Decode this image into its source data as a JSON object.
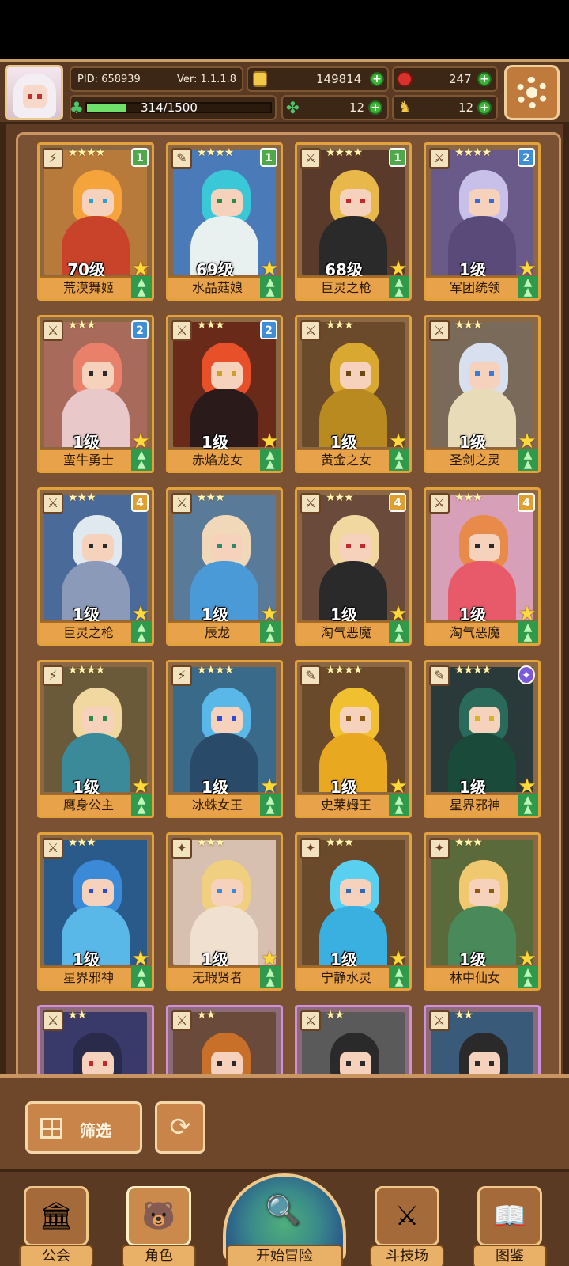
{
  "header": {
    "pid": "PID: 658939",
    "version": "Ver: 1.1.1.8",
    "energy": "314/1500",
    "energy_fraction": 0.21,
    "gold": "149814",
    "apples": "247",
    "clovers": "12",
    "trophies": "12"
  },
  "cards": [
    {
      "level": "70级",
      "name": "荒漠舞姬",
      "stars": "★★★★",
      "badge": "1",
      "badge_class": "b1",
      "type_icon": "⚡",
      "hair": "#f4a43a",
      "body": "#c8432a",
      "eye": "#2aa0d8",
      "bg": "#b87a3a"
    },
    {
      "level": "69级",
      "name": "水晶菇娘",
      "stars": "★★★★",
      "badge": "1",
      "badge_class": "b1",
      "type_icon": "✎",
      "hair": "#3ac8d8",
      "body": "#e8f0f0",
      "eye": "#2a8a4a",
      "bg": "#4a7ab8"
    },
    {
      "level": "68级",
      "name": "巨灵之枪",
      "stars": "★★★★",
      "badge": "1",
      "badge_class": "b1",
      "type_icon": "⚔",
      "hair": "#e8b84a",
      "body": "#2a2a2a",
      "eye": "#c02a2a",
      "bg": "#5a3a2a"
    },
    {
      "level": "1级",
      "name": "军团统领",
      "stars": "★★★★",
      "badge": "2",
      "badge_class": "b2",
      "type_icon": "⚔",
      "hair": "#c8c0e8",
      "body": "#5a4a7a",
      "eye": "#3a6ad8",
      "bg": "#6a5a8a"
    },
    {
      "level": "1级",
      "name": "蛮牛勇士",
      "stars": "★★★",
      "badge": "2",
      "badge_class": "b2",
      "type_icon": "⚔",
      "hair": "#e8806a",
      "body": "#e8c8c8",
      "eye": "#2a2a2a",
      "bg": "#a86a5a"
    },
    {
      "level": "1级",
      "name": "赤焰龙女",
      "stars": "★★★",
      "badge": "2",
      "badge_class": "b2",
      "type_icon": "⚔",
      "hair": "#e8502a",
      "body": "#2a1a1a",
      "eye": "#c8a02a",
      "bg": "#6a2a1a"
    },
    {
      "level": "1级",
      "name": "黄金之女",
      "stars": "★★★",
      "badge": "",
      "badge_class": "",
      "type_icon": "⚔",
      "hair": "#d8a830",
      "body": "#b88a20",
      "eye": "#6a4a10",
      "bg": "#6a4a2a"
    },
    {
      "level": "1级",
      "name": "圣剑之灵",
      "stars": "★★★",
      "badge": "",
      "badge_class": "",
      "type_icon": "⚔",
      "hair": "#d8e0f0",
      "body": "#e8dcb8",
      "eye": "#3a7ad8",
      "bg": "#7a6a5a"
    },
    {
      "level": "1级",
      "name": "巨灵之枪",
      "stars": "★★★",
      "badge": "4",
      "badge_class": "b4",
      "type_icon": "⚔",
      "hair": "#e0e8f0",
      "body": "#8a9ab8",
      "eye": "#2a2a2a",
      "bg": "#4a6a9a"
    },
    {
      "level": "1级",
      "name": "辰龙",
      "stars": "★★★",
      "badge": "",
      "badge_class": "",
      "type_icon": "⚔",
      "hair": "#f0d8b8",
      "body": "#4a9ad8",
      "eye": "#2a8a6a",
      "bg": "#5a7a9a"
    },
    {
      "level": "1级",
      "name": "淘气恶魔",
      "stars": "★★★",
      "badge": "4",
      "badge_class": "b4",
      "type_icon": "⚔",
      "hair": "#f0d8a0",
      "body": "#2a2a2a",
      "eye": "#c02a2a",
      "bg": "#6a4a3a"
    },
    {
      "level": "1级",
      "name": "淘气恶魔",
      "stars": "★★★",
      "badge": "4",
      "badge_class": "b4",
      "type_icon": "⚔",
      "hair": "#e88a4a",
      "body": "#e85a6a",
      "eye": "#2a2a2a",
      "bg": "#d8a0b8"
    },
    {
      "level": "1级",
      "name": "鹰身公主",
      "stars": "★★★★",
      "badge": "",
      "badge_class": "",
      "type_icon": "⚡",
      "hair": "#f0d8a0",
      "body": "#3a8a9a",
      "eye": "#2a8a4a",
      "bg": "#6a5a3a"
    },
    {
      "level": "1级",
      "name": "冰蛛女王",
      "stars": "★★★★",
      "badge": "",
      "badge_class": "",
      "type_icon": "⚡",
      "hair": "#5ab8e8",
      "body": "#2a4a6a",
      "eye": "#2a4ad8",
      "bg": "#3a6a8a"
    },
    {
      "level": "1级",
      "name": "史莱姆王",
      "stars": "★★★★",
      "badge": "",
      "badge_class": "",
      "type_icon": "✎",
      "hair": "#f0c030",
      "body": "#e8a820",
      "eye": "#8a5a10",
      "bg": "#6a4a2a"
    },
    {
      "level": "1级",
      "name": "星界邪神",
      "stars": "★★★★",
      "badge": "✦",
      "badge_class": "bx",
      "type_icon": "✎",
      "hair": "#2a6a5a",
      "body": "#1a4a3a",
      "eye": "#d8b02a",
      "bg": "#2a3a3a"
    },
    {
      "level": "1级",
      "name": "星界邪神",
      "stars": "★★★",
      "badge": "",
      "badge_class": "",
      "type_icon": "⚔",
      "hair": "#3a8ad8",
      "body": "#5ab8e8",
      "eye": "#2a4ad8",
      "bg": "#2a5a8a"
    },
    {
      "level": "1级",
      "name": "无瑕贤者",
      "stars": "★★★",
      "badge": "",
      "badge_class": "",
      "type_icon": "✦",
      "hair": "#f0d080",
      "body": "#f0e0d0",
      "eye": "#3a8ad8",
      "bg": "#d8c0b0"
    },
    {
      "level": "1级",
      "name": "宁静水灵",
      "stars": "★★★",
      "badge": "",
      "badge_class": "",
      "type_icon": "✦",
      "hair": "#5ad0f0",
      "body": "#3ab0e0",
      "eye": "#2a6ab8",
      "bg": "#6a4a2a"
    },
    {
      "level": "1级",
      "name": "林中仙女",
      "stars": "★★★",
      "badge": "",
      "badge_class": "",
      "type_icon": "✦",
      "hair": "#f0c870",
      "body": "#4a8a5a",
      "eye": "#8a5a10",
      "bg": "#5a6a3a"
    },
    {
      "level": "",
      "name": "",
      "stars": "★★",
      "badge": "",
      "badge_class": "",
      "type_icon": "⚔",
      "hair": "#2a2a4a",
      "body": "#4a3a6a",
      "eye": "#c02a2a",
      "bg": "#3a3a6a"
    },
    {
      "level": "",
      "name": "",
      "stars": "★★",
      "badge": "",
      "badge_class": "",
      "type_icon": "⚔",
      "hair": "#c8702a",
      "body": "#8a4a2a",
      "eye": "#2a2a2a",
      "bg": "#6a4a3a"
    },
    {
      "level": "",
      "name": "",
      "stars": "★★",
      "badge": "",
      "badge_class": "",
      "type_icon": "⚔",
      "hair": "#2a2a2a",
      "body": "#d8d8d8",
      "eye": "#2a2a2a",
      "bg": "#5a5a5a"
    },
    {
      "level": "",
      "name": "",
      "stars": "★★",
      "badge": "",
      "badge_class": "",
      "type_icon": "⚔",
      "hair": "#2a2a2a",
      "body": "#c8a030",
      "eye": "#2a2a2a",
      "bg": "#3a5a7a"
    }
  ],
  "controls": {
    "filter_label": "筛选",
    "reset_icon": "⟳"
  },
  "nav": {
    "guild": "公会",
    "character": "角色",
    "adventure": "开始冒险",
    "arena": "斗技场",
    "codex": "图鉴"
  },
  "icons": {
    "guild": "🏛",
    "character": "🐻",
    "adventure": "🔍",
    "arena": "⚔",
    "codex": "📖"
  }
}
